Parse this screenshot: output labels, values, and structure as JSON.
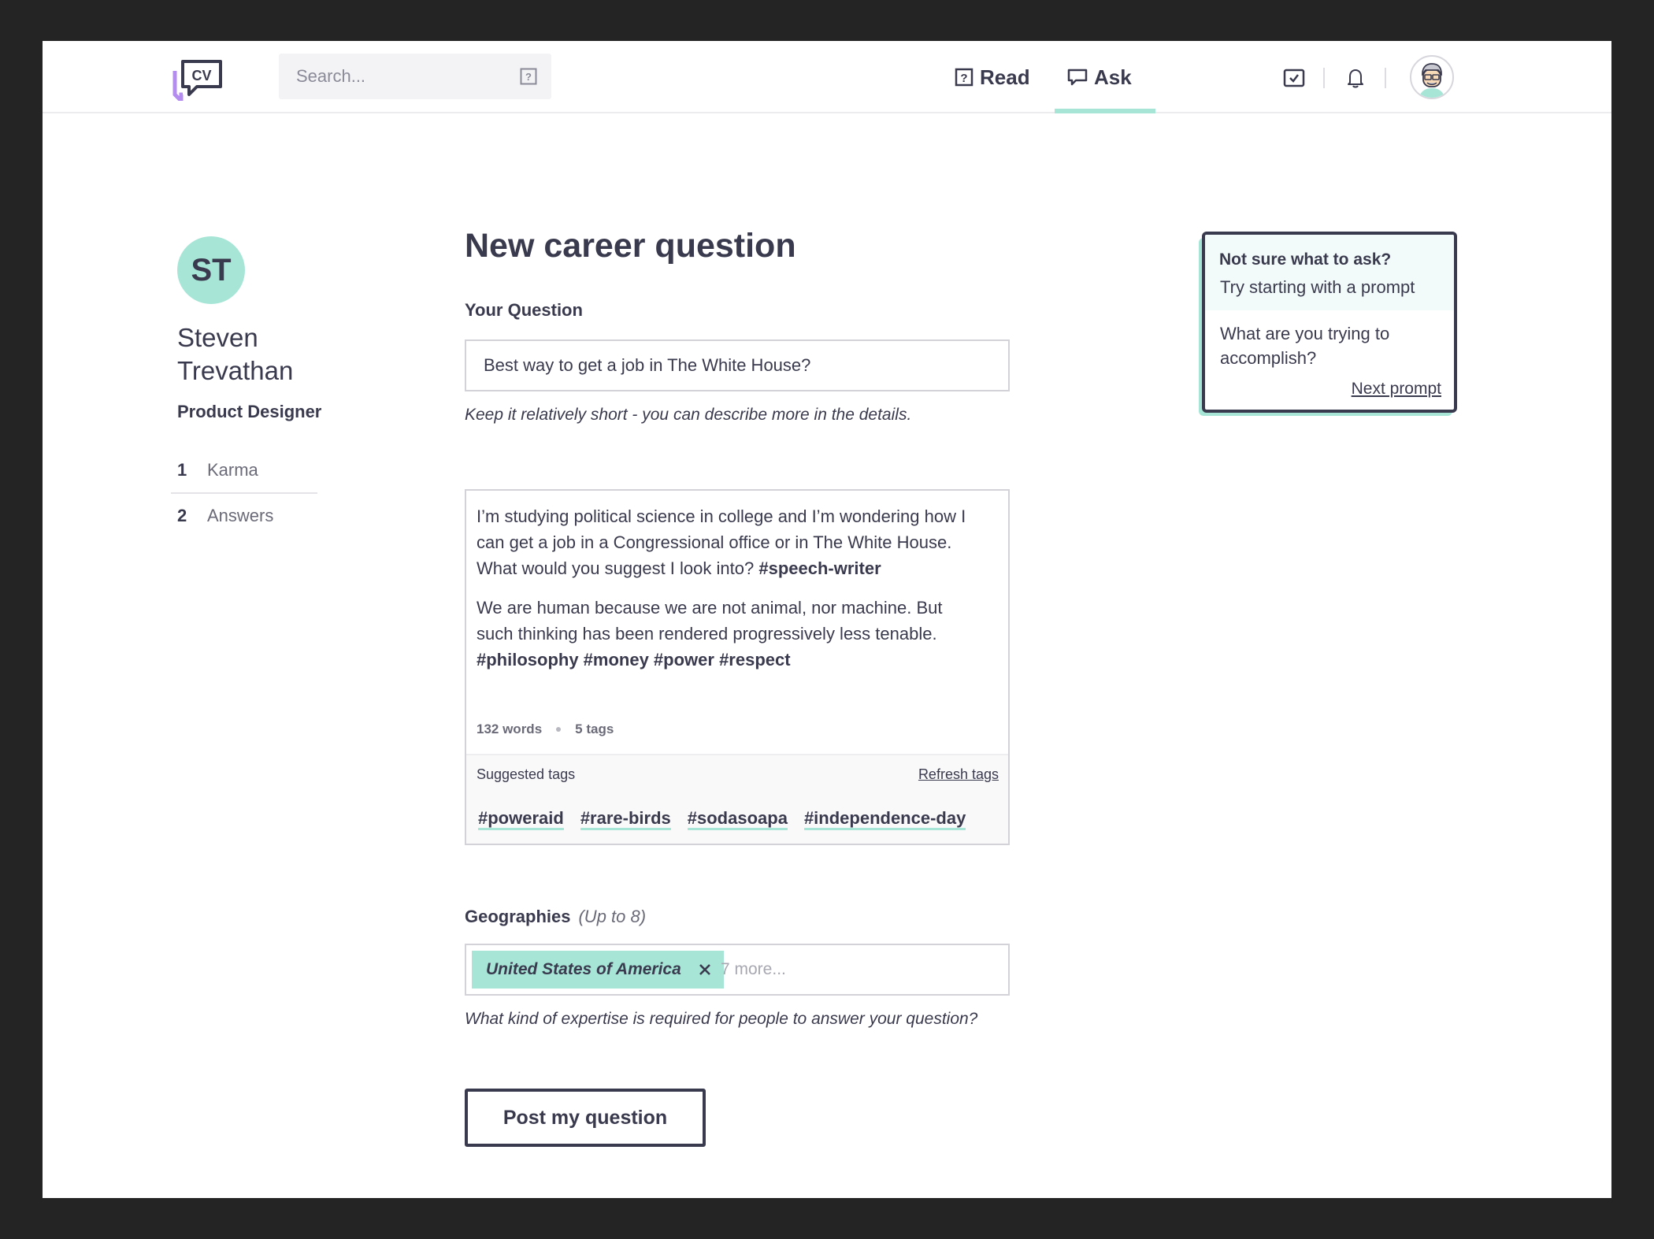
{
  "header": {
    "logo_text": "CV",
    "search_placeholder": "Search...",
    "nav": {
      "read_label": "Read",
      "ask_label": "Ask",
      "active": "Ask"
    }
  },
  "profile": {
    "initials": "ST",
    "name": "Steven Trevathan",
    "role": "Product Designer",
    "stats": [
      {
        "value": "1",
        "label": "Karma"
      },
      {
        "value": "2",
        "label": "Answers"
      }
    ]
  },
  "form": {
    "title": "New career question",
    "question_label": "Your Question",
    "question_value": "Best way to get a job in The White House?",
    "question_hint": "Keep it relatively short - you can describe more in the details.",
    "details": {
      "p1_text": "I’m studying political science in college and I’m wondering how I can get a job in a Congressional office or in The White House. What would you suggest I look into?",
      "p1_tag": "#speech-writer",
      "p2_text": "We are human because we are not animal, nor machine. But such thinking has been rendered progressively less tenable.",
      "p2_tags": "#philosophy #money #power #respect",
      "word_count": "132 words",
      "tag_count": "5 tags"
    },
    "suggested": {
      "label": "Suggested tags",
      "refresh_label": "Refresh tags",
      "tags": [
        "#poweraid",
        "#rare-birds",
        "#sodasoapa",
        "#independence-day"
      ]
    },
    "geographies": {
      "label": "Geographies",
      "sub_label": "(Up to 8)",
      "selected": "United States of America",
      "more_placeholder": "7 more...",
      "hint": "What kind of expertise is required for people to answer your question?"
    },
    "submit_label": "Post my question"
  },
  "prompt_card": {
    "title": "Not sure what to ask?",
    "subtitle": "Try starting with a prompt",
    "prompt": "What are you trying to accomplish?",
    "next_label": "Next prompt"
  },
  "colors": {
    "accent": "#a7e6d7",
    "text": "#3a3a4e",
    "logo_purple": "#b48cf0",
    "background": "#242424"
  }
}
